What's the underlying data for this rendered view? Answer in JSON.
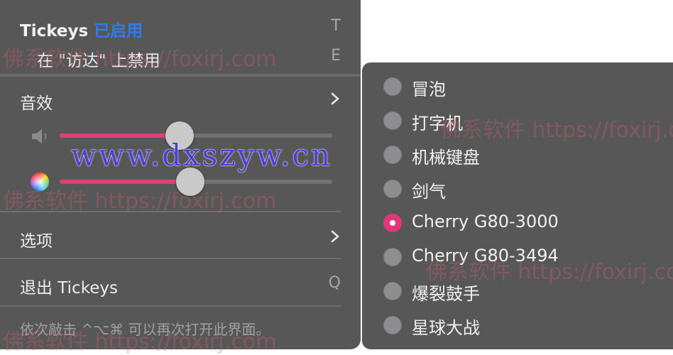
{
  "menu": {
    "header": {
      "app": "Tickeys",
      "status": "已启用",
      "shortcut": "T"
    },
    "disable_item": {
      "label": "在 \"访达\" 上禁用",
      "shortcut": "E"
    },
    "sound": {
      "label": "音效"
    },
    "volume": {
      "level": 0.44
    },
    "pitch": {
      "level": 0.48
    },
    "options": {
      "label": "选项"
    },
    "quit": {
      "label": "退出 Tickeys",
      "shortcut": "Q"
    },
    "footnote": "依次敲击 ^⌥⌘ 可以再次打开此界面。"
  },
  "submenu": {
    "items": [
      {
        "label": "冒泡",
        "selected": false
      },
      {
        "label": "打字机",
        "selected": false
      },
      {
        "label": "机械键盘",
        "selected": false
      },
      {
        "label": "剑气",
        "selected": false
      },
      {
        "label": "Cherry G80-3000",
        "selected": true
      },
      {
        "label": "Cherry G80-3494",
        "selected": false
      },
      {
        "label": "爆裂鼓手",
        "selected": false
      },
      {
        "label": "星球大战",
        "selected": false
      }
    ]
  },
  "watermarks": {
    "a": "佛系软件 https://foxirj.com",
    "b": "www.dxszyw.cn",
    "c": "佛系软件 https://foxirj.com",
    "d": "佛系软件 https://foxirj.com",
    "e": "佛系软件 https://foxirj.com",
    "f": "佛系软件 https://foxirj.com"
  },
  "colors": {
    "menu_bg": "#575758",
    "accent_pink": "#e6347a",
    "status_blue": "#2c7cf3"
  },
  "icons": {
    "volume": "speaker-icon",
    "pitch": "color-wheel-icon",
    "submenu": "chevron-right-icon"
  }
}
